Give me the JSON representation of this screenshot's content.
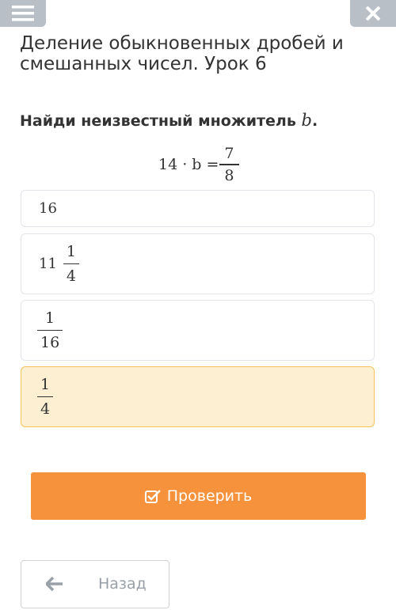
{
  "header": {
    "menu_icon": "hamburger-icon",
    "close_icon": "close-icon"
  },
  "lesson": {
    "title": "Деление обыкновенных дробей и смешанных чисел. Урок 6"
  },
  "task": {
    "text": "Найди неизвестный множитель ",
    "variable": "b",
    "period": ".",
    "equation": {
      "left": "14 · b =",
      "numerator": "7",
      "denominator": "8"
    }
  },
  "options": [
    {
      "type": "integer",
      "value": "16"
    },
    {
      "type": "mixed",
      "whole": "11",
      "numerator": "1",
      "denominator": "4"
    },
    {
      "type": "fraction",
      "numerator": "1",
      "denominator": "16"
    },
    {
      "type": "fraction",
      "numerator": "1",
      "denominator": "4",
      "selected": true
    }
  ],
  "buttons": {
    "check": "Проверить",
    "back": "Назад"
  },
  "colors": {
    "accent": "#f6923c",
    "selected_bg": "#fdf0d2",
    "selected_border": "#f3c25a",
    "topbar": "#b9bfc7"
  }
}
